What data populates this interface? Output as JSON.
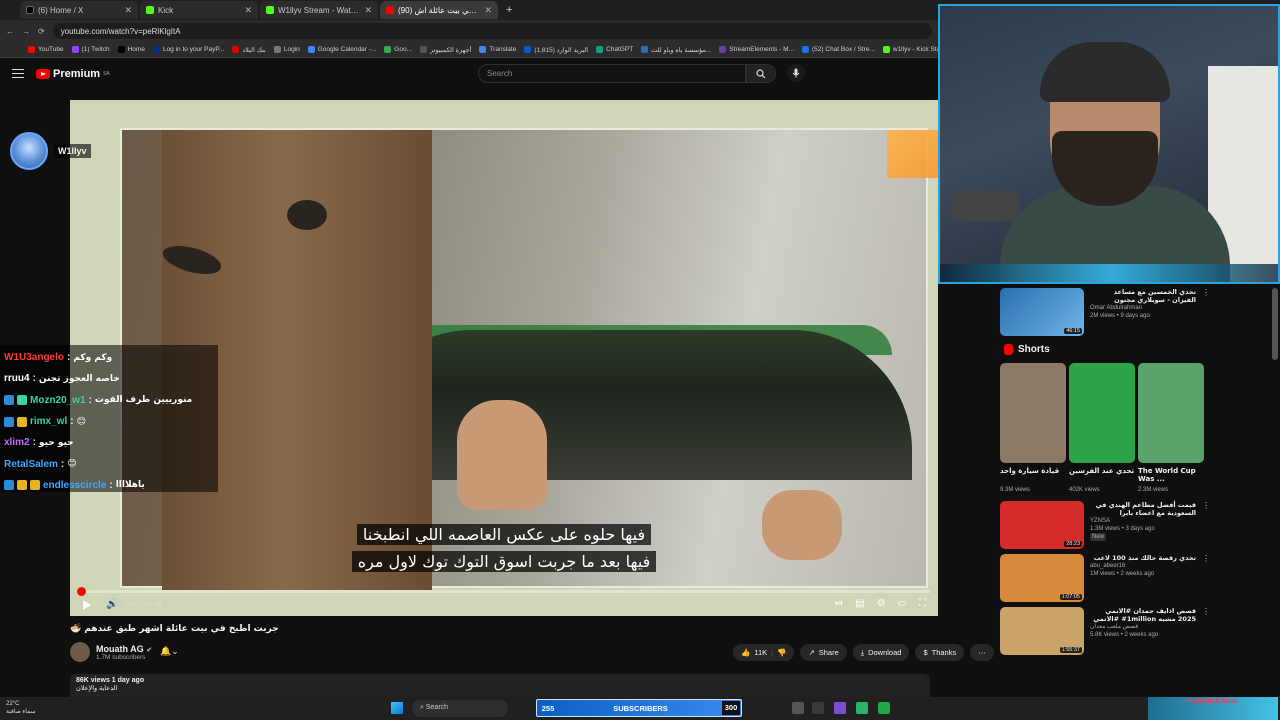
{
  "browser": {
    "tabs": [
      {
        "label": "(6) Home / X",
        "color": "#000000",
        "active": false
      },
      {
        "label": "Kick",
        "color": "#53fc18",
        "active": false
      },
      {
        "label": "W1llyv Stream - Watch Live on",
        "color": "#53fc18",
        "active": false
      },
      {
        "label": "(90) جربت اطبخ في بيت عائلة اش",
        "color": "#ff0000",
        "active": true
      }
    ],
    "url": "youtube.com/watch?v=peRlKlgItA",
    "bookmarks": [
      "YouTube",
      "(1) Twitch",
      "Home",
      "Log in to your PayP...",
      "بنك البلاد",
      "Login",
      "Google Calendar -...",
      "Goo...",
      "أجهزة الكمبيوتر",
      "Translate",
      "(1,815) البريد الوارد",
      "ChatGPT",
      "مؤسسة باه وباو للت...",
      "StreamElements - M...",
      "(52) Chat Box / Stre...",
      "w1llyv - Kick Stats,..."
    ]
  },
  "youtube": {
    "logo": "Premium",
    "logo_region": "SA",
    "search_placeholder": "Search"
  },
  "video": {
    "subtitle_line1": "فيها حلوه على عكس العاصمه اللي انطبخنا",
    "subtitle_line2": "فيها بعد ما جربت اسوق التوك توك لاول مره",
    "time": "0:10 / 40:32",
    "progress": 0.004,
    "title": "جربت اطبخ في بيت عائلة اشهر طبق عندهم 🍜",
    "channel": "Mouath AG",
    "subscribers": "1.7M subscribers",
    "likes": "11K",
    "share": "Share",
    "download": "Download",
    "thanks": "Thanks",
    "views": "86K views  1 day ago",
    "desc_line": "الدعاية والإعلان"
  },
  "stream": {
    "channel_name": "W1llyv",
    "chat": [
      {
        "user": "W1U3angelo",
        "user_color": "#ff3b3b",
        "msg": "وكم وكم",
        "badges": []
      },
      {
        "user": "rruu4",
        "user_color": "#ffffff",
        "msg": "خاصه العجوز تجنن",
        "badges": []
      },
      {
        "user": "Mozn20_w1",
        "user_color": "#35d6a0",
        "msg": "منورييين طرف القوت",
        "badges": [
          "#2a8bd6",
          "#35d6a0"
        ]
      },
      {
        "user": "rimx_wl",
        "user_color": "#35d6a0",
        "msg": "😊",
        "badges": [
          "#2a8bd6",
          "#e6b422"
        ]
      },
      {
        "user": "xlim2",
        "user_color": "#c06bff",
        "msg": "حيو حيو",
        "badges": []
      },
      {
        "user": "RetalSalem",
        "user_color": "#3fa9ff",
        "msg": "😊",
        "badges": []
      },
      {
        "user": "endlesscircle",
        "user_color": "#3fa9ff",
        "msg": "ياهلاااا",
        "badges": [
          "#2a8bd6",
          "#e6b422",
          "#e6b422"
        ]
      }
    ]
  },
  "sidebar": {
    "top_item": {
      "title": "تحدي الخمسين مع مساعد الفيزان - سوبلاري مجنون",
      "channel": "Omar Abdulrahman",
      "meta": "2M views • 9 days ago",
      "duration": "46:15"
    },
    "shorts_title": "Shorts",
    "shorts": [
      {
        "title": "قيادة سيارة واحد",
        "views": "9.3M views",
        "color": "#8c7a66"
      },
      {
        "title": "تحدي عند الفرسين",
        "views": "402K views",
        "color": "#2fa34a"
      },
      {
        "title": "The World Cup Was ...",
        "views": "2.3M views",
        "color": "#5aa36a"
      }
    ],
    "items": [
      {
        "title": "قيمت أفضل مطاعم الهندي في السعودية مع اعضاء بابرا",
        "channel": "YZNSA",
        "meta": "1.3M views • 3 days ago",
        "tag": "New",
        "duration": "28:23",
        "color": "#d62b2b"
      },
      {
        "title": "تحدي رقصة حالك منذ 100 لاعب",
        "channel": "abu_abeer16",
        "meta": "1M views • 2 weeks ago",
        "tag": "",
        "duration": "1:07:05",
        "color": "#d88a3c"
      },
      {
        "title": "قصص اذايف حمدان #الانمي 2025 مشبه 1million# #الانمي",
        "channel": "قصص ملعب معدان",
        "meta": "5.8K views • 2 weeks ago",
        "tag": "",
        "duration": "1:55:37",
        "color": "#c9a36a"
      }
    ]
  },
  "taskbar": {
    "temp": "22°C",
    "weather": "سماء صافية",
    "search": "Search",
    "subs_count": "255",
    "subs_label": "SUBSCRIBERS",
    "subs_goal": "300",
    "status": "AVAILABLE NOW!"
  }
}
